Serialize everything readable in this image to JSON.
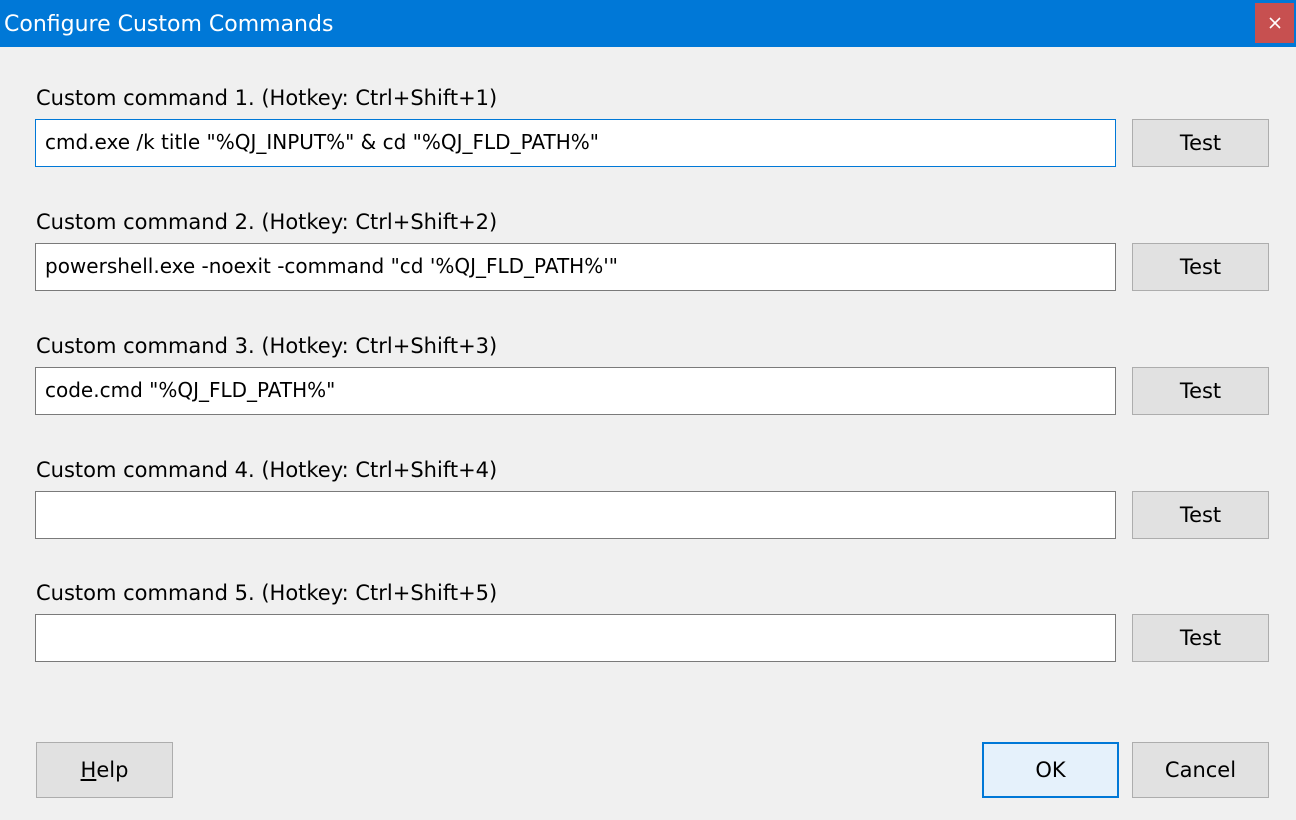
{
  "window": {
    "title": "Configure Custom Commands"
  },
  "commands": [
    {
      "label": "Custom command 1. (Hotkey: Ctrl+Shift+1)",
      "value": "cmd.exe /k title \"%QJ_INPUT%\" & cd \"%QJ_FLD_PATH%\"",
      "test_label": "Test"
    },
    {
      "label": "Custom command 2. (Hotkey: Ctrl+Shift+2)",
      "value": "powershell.exe -noexit -command \"cd '%QJ_FLD_PATH%'\"",
      "test_label": "Test"
    },
    {
      "label": "Custom command 3. (Hotkey: Ctrl+Shift+3)",
      "value": "code.cmd \"%QJ_FLD_PATH%\"",
      "test_label": "Test"
    },
    {
      "label": "Custom command 4. (Hotkey: Ctrl+Shift+4)",
      "value": "",
      "test_label": "Test"
    },
    {
      "label": "Custom command 5. (Hotkey: Ctrl+Shift+5)",
      "value": "",
      "test_label": "Test"
    }
  ],
  "footer": {
    "help_first": "H",
    "help_rest": "elp",
    "ok_label": "OK",
    "cancel_label": "Cancel"
  },
  "icons": {
    "close": "close-icon"
  },
  "colors": {
    "titlebar": "#0078d7",
    "close_button": "#c75050",
    "focus_border": "#0078d7",
    "background": "#f0f0f0"
  }
}
